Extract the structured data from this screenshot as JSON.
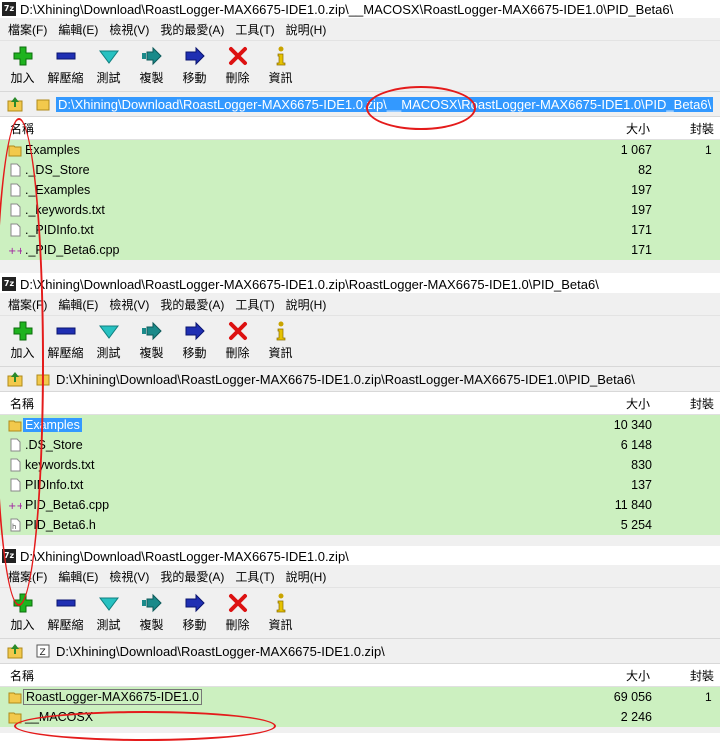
{
  "menu": [
    "檔案(F)",
    "編輯(E)",
    "檢視(V)",
    "我的最愛(A)",
    "工具(T)",
    "說明(H)"
  ],
  "toolbar": [
    {
      "icon": "add-icon",
      "label": "加入"
    },
    {
      "icon": "extract-icon",
      "label": "解壓縮"
    },
    {
      "icon": "test-icon",
      "label": "測試"
    },
    {
      "icon": "copy-icon",
      "label": "複製"
    },
    {
      "icon": "move-icon",
      "label": "移動"
    },
    {
      "icon": "delete-icon",
      "label": "刪除"
    },
    {
      "icon": "info-icon",
      "label": "資訊"
    }
  ],
  "columns": {
    "name": "名稱",
    "size": "大小",
    "packed": "封裝"
  },
  "app_icon_text": "7z",
  "colors": {
    "row_bg": "#ccf0c0",
    "selection": "#3399ff",
    "annotation": "#e41b1b"
  },
  "panels": [
    {
      "title": "D:\\Xhining\\Download\\RoastLogger-MAX6675-IDE1.0.zip\\__MACOSX\\RoastLogger-MAX6675-IDE1.0\\PID_Beta6\\",
      "path": "D:\\Xhining\\Download\\RoastLogger-MAX6675-IDE1.0.zip\\__MACOSX\\RoastLogger-MAX6675-IDE1.0\\PID_Beta6\\",
      "rows": [
        {
          "name": "Examples",
          "size": "1 067",
          "icon": "folder-icon"
        },
        {
          "name": "._DS_Store",
          "size": "82",
          "icon": "file-icon"
        },
        {
          "name": "._Examples",
          "size": "197",
          "icon": "file-icon"
        },
        {
          "name": "._keywords.txt",
          "size": "197",
          "icon": "file-icon"
        },
        {
          "name": "._PIDInfo.txt",
          "size": "171",
          "icon": "file-icon"
        },
        {
          "name": "._PID_Beta6.cpp",
          "size": "171",
          "icon": "cpp-file-icon"
        }
      ],
      "extra_values": [
        "1",
        "",
        "",
        "",
        "",
        ""
      ]
    },
    {
      "title": "D:\\Xhining\\Download\\RoastLogger-MAX6675-IDE1.0.zip\\RoastLogger-MAX6675-IDE1.0\\PID_Beta6\\",
      "path": "D:\\Xhining\\Download\\RoastLogger-MAX6675-IDE1.0.zip\\RoastLogger-MAX6675-IDE1.0\\PID_Beta6\\",
      "rows": [
        {
          "name": "Examples",
          "size": "10 340",
          "icon": "folder-icon"
        },
        {
          "name": ".DS_Store",
          "size": "6 148",
          "icon": "file-icon"
        },
        {
          "name": "keywords.txt",
          "size": "830",
          "icon": "file-icon"
        },
        {
          "name": "PIDInfo.txt",
          "size": "137",
          "icon": "file-icon"
        },
        {
          "name": "PID_Beta6.cpp",
          "size": "11 840",
          "icon": "cpp-file-icon"
        },
        {
          "name": "PID_Beta6.h",
          "size": "5 254",
          "icon": "header-file-icon"
        }
      ]
    },
    {
      "title": "D:\\Xhining\\Download\\RoastLogger-MAX6675-IDE1.0.zip\\",
      "path": "D:\\Xhining\\Download\\RoastLogger-MAX6675-IDE1.0.zip\\",
      "rows": [
        {
          "name": "RoastLogger-MAX6675-IDE1.0",
          "size": "69 056",
          "icon": "folder-icon"
        },
        {
          "name": "__MACOSX",
          "size": "2 246",
          "icon": "folder-icon"
        }
      ],
      "extra_values": [
        "1",
        "",
        "",
        "",
        "",
        ""
      ]
    }
  ]
}
